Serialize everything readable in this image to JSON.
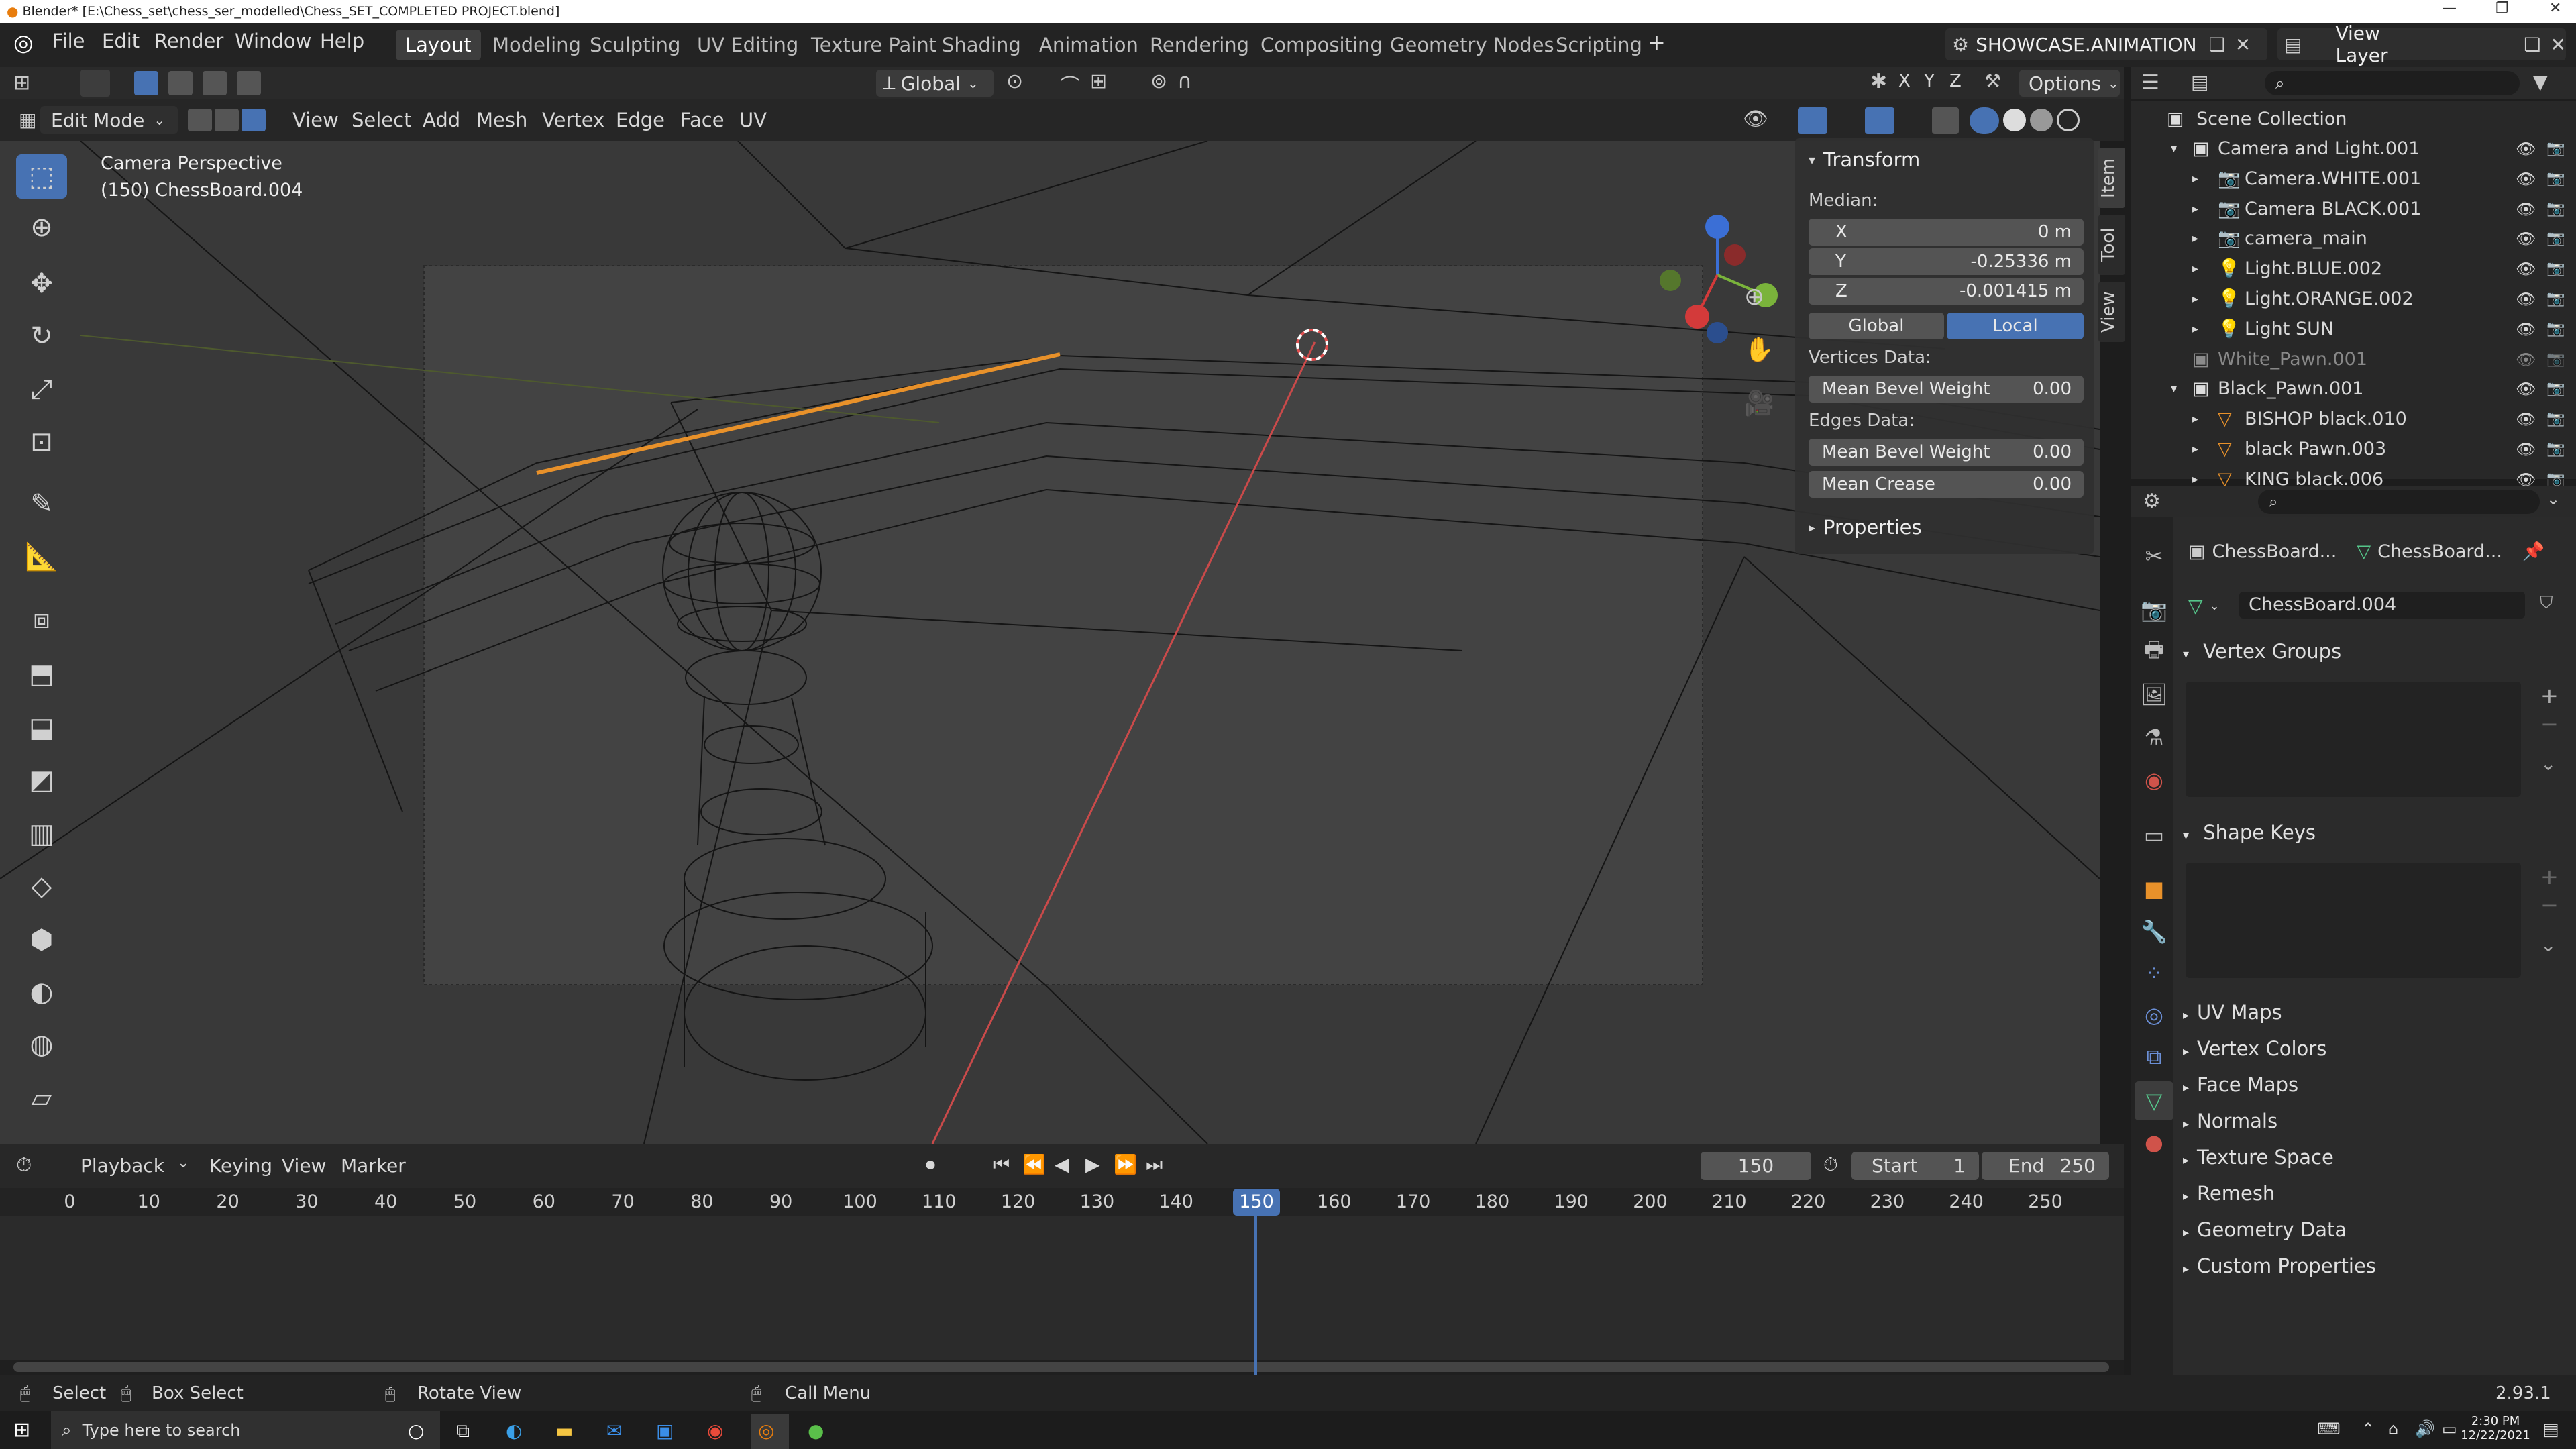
{
  "window": {
    "title": "Blender* [E:\\Chess_set\\chess_ser_modelled\\Chess_SET_COMPLETED PROJECT.blend]"
  },
  "menu": [
    "File",
    "Edit",
    "Render",
    "Window",
    "Help"
  ],
  "workspaces": [
    "Layout",
    "Modeling",
    "Sculpting",
    "UV Editing",
    "Texture Paint",
    "Shading",
    "Animation",
    "Rendering",
    "Compositing",
    "Geometry Nodes",
    "Scripting"
  ],
  "scene_name": "SHOWCASE.ANIMATION",
  "view_layer": "View Layer",
  "viewport_header": {
    "orientation": "Global",
    "options": "Options",
    "axes": [
      "X",
      "Y",
      "Z"
    ],
    "mode": "Edit Mode",
    "menus": [
      "View",
      "Select",
      "Add",
      "Mesh",
      "Vertex",
      "Edge",
      "Face",
      "UV"
    ]
  },
  "viewport_overlay": {
    "line1": "Camera Perspective",
    "line2": "(150) ChessBoard.004"
  },
  "npanel": {
    "section": "Transform",
    "median_label": "Median:",
    "x_label": "X",
    "x_value": "0 m",
    "y_label": "Y",
    "y_value": "-0.25336 m",
    "z_label": "Z",
    "z_value": "-0.001415 m",
    "global_btn": "Global",
    "local_btn": "Local",
    "vertices_data": "Vertices Data:",
    "mean_bevel_weight_v": "Mean Bevel Weight",
    "mean_bevel_weight_v_val": "0.00",
    "edges_data": "Edges Data:",
    "mean_bevel_weight_e": "Mean Bevel Weight",
    "mean_bevel_weight_e_val": "0.00",
    "mean_crease": "Mean Crease",
    "mean_crease_val": "0.00",
    "properties": "Properties",
    "tabs": [
      "Item",
      "Tool",
      "View"
    ]
  },
  "outliner": {
    "scene_collection": "Scene Collection",
    "items": [
      {
        "label": "Camera and Light.001",
        "indent": 1
      },
      {
        "label": "Camera.WHITE.001",
        "indent": 2
      },
      {
        "label": "Camera BLACK.001",
        "indent": 2
      },
      {
        "label": "camera_main",
        "indent": 2
      },
      {
        "label": "Light.BLUE.002",
        "indent": 2
      },
      {
        "label": "Light.ORANGE.002",
        "indent": 2
      },
      {
        "label": "Light SUN",
        "indent": 2
      },
      {
        "label": "White_Pawn.001",
        "indent": 1
      },
      {
        "label": "Black_Pawn.001",
        "indent": 1
      },
      {
        "label": "BISHOP black.010",
        "indent": 2
      },
      {
        "label": "black Pawn.003",
        "indent": 2
      },
      {
        "label": "KING black.006",
        "indent": 2
      }
    ]
  },
  "properties": {
    "breadcrumb_obj": "ChessBoard...",
    "breadcrumb_data": "ChessBoard...",
    "data_name": "ChessBoard.004",
    "vertex_groups": "Vertex Groups",
    "shape_keys": "Shape Keys",
    "collapsed": [
      "UV Maps",
      "Vertex Colors",
      "Face Maps",
      "Normals",
      "Texture Space",
      "Remesh",
      "Geometry Data",
      "Custom Properties"
    ]
  },
  "timeline": {
    "menus": [
      "Playback",
      "Keying",
      "View",
      "Marker"
    ],
    "current_frame": "150",
    "start_label": "Start",
    "start_value": "1",
    "end_label": "End",
    "end_value": "250",
    "ticks": [
      "0",
      "10",
      "20",
      "30",
      "40",
      "50",
      "60",
      "70",
      "80",
      "90",
      "100",
      "110",
      "120",
      "130",
      "140",
      "150",
      "160",
      "170",
      "180",
      "190",
      "200",
      "210",
      "220",
      "230",
      "240",
      "250"
    ]
  },
  "statusbar": {
    "select": "Select",
    "box_select": "Box Select",
    "rotate_view": "Rotate View",
    "call_menu": "Call Menu",
    "version": "2.93.1"
  },
  "taskbar": {
    "search_placeholder": "Type here to search",
    "time": "2:30 PM",
    "date": "12/22/2021"
  },
  "colors": {
    "accent": "#4772b3",
    "selected_edge": "#e8912a",
    "wire": "#141414"
  }
}
